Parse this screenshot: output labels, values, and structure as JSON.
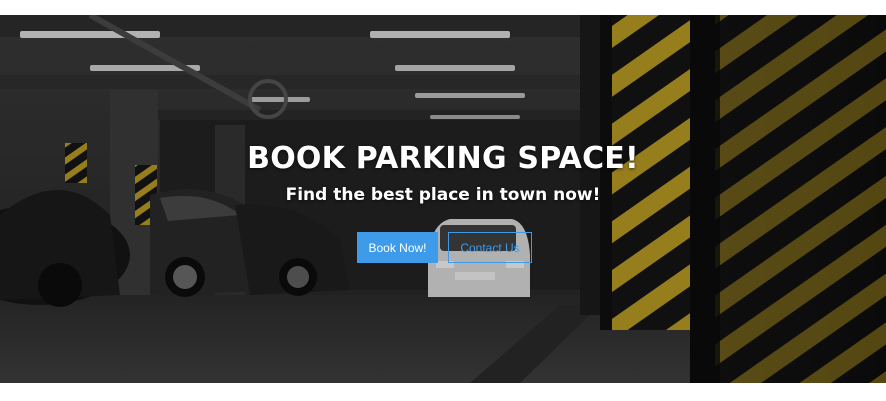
{
  "hero": {
    "title": "BOOK PARKING SPACE!",
    "subtitle": "Find the best place in town now!",
    "buttons": {
      "book_label": "Book Now!",
      "contact_label": "Contact Us"
    },
    "background_image": "underground-parking-garage-photo"
  },
  "colors": {
    "accent": "#3d9be9",
    "text": "#ffffff",
    "hazard_yellow": "#c8a526"
  }
}
